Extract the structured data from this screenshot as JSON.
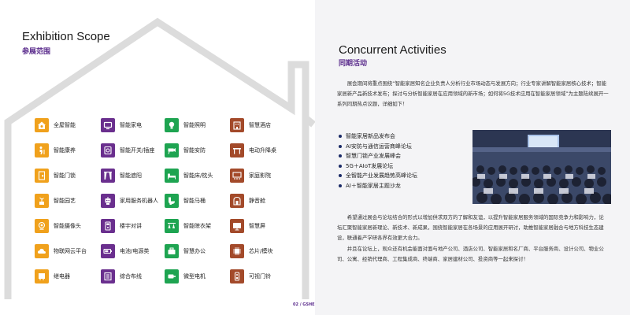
{
  "left": {
    "title_en": "Exhibition Scope",
    "title_cn": "参展范围",
    "items": [
      {
        "label": "全屋智能",
        "icon": "home-gear-icon",
        "color": "#f0a11c"
      },
      {
        "label": "智能家电",
        "icon": "tv-icon",
        "color": "#6a2f8e"
      },
      {
        "label": "智能照明",
        "icon": "bulb-icon",
        "color": "#1ea451"
      },
      {
        "label": "智慧酒店",
        "icon": "hotel-icon",
        "color": "#a34a2a"
      },
      {
        "label": "智能康养",
        "icon": "elderly-care-icon",
        "color": "#f0a11c"
      },
      {
        "label": "智能开关/插座",
        "icon": "power-switch-icon",
        "color": "#6a2f8e"
      },
      {
        "label": "智能安防",
        "icon": "camera-icon",
        "color": "#1ea451"
      },
      {
        "label": "电动升降桌",
        "icon": "desk-icon",
        "color": "#a34a2a"
      },
      {
        "label": "智能门锁",
        "icon": "door-lock-icon",
        "color": "#f0a11c"
      },
      {
        "label": "智能遮阳",
        "icon": "curtain-icon",
        "color": "#6a2f8e"
      },
      {
        "label": "智能床/枕头",
        "icon": "bed-icon",
        "color": "#1ea451"
      },
      {
        "label": "家庭影院",
        "icon": "theater-icon",
        "color": "#a34a2a"
      },
      {
        "label": "智能园艺",
        "icon": "garden-icon",
        "color": "#f0a11c"
      },
      {
        "label": "家用服务机器人",
        "icon": "robot-icon",
        "color": "#6a2f8e"
      },
      {
        "label": "智能马桶",
        "icon": "toilet-icon",
        "color": "#1ea451"
      },
      {
        "label": "静音舱",
        "icon": "pod-icon",
        "color": "#a34a2a"
      },
      {
        "label": "智能摄像头",
        "icon": "webcam-icon",
        "color": "#f0a11c"
      },
      {
        "label": "楼宇对讲",
        "icon": "intercom-icon",
        "color": "#6a2f8e"
      },
      {
        "label": "智能晾衣架",
        "icon": "clothes-rack-icon",
        "color": "#1ea451"
      },
      {
        "label": "智慧屏",
        "icon": "screen-icon",
        "color": "#a34a2a"
      },
      {
        "label": "物联网云平台",
        "icon": "cloud-icon",
        "color": "#f0a11c"
      },
      {
        "label": "电池/电源类",
        "icon": "battery-icon",
        "color": "#6a2f8e"
      },
      {
        "label": "智慧办公",
        "icon": "office-icon",
        "color": "#1ea451"
      },
      {
        "label": "芯片/模块",
        "icon": "chip-icon",
        "color": "#a34a2a"
      },
      {
        "label": "继电器",
        "icon": "relay-icon",
        "color": "#f0a11c"
      },
      {
        "label": "综合布线",
        "icon": "wiring-icon",
        "color": "#6a2f8e"
      },
      {
        "label": "微型电机",
        "icon": "motor-icon",
        "color": "#1ea451"
      },
      {
        "label": "可视门铃",
        "icon": "doorbell-icon",
        "color": "#a34a2a"
      }
    ]
  },
  "right": {
    "title_en": "Concurrent Activities",
    "title_cn": "同期活动",
    "intro": "展会期间将重点围绕“智能家居知名企业负责人分析行业市场动态与发展方向；行业专家讲解智能家居核心技术；智能家居新产品新技术发布；探讨与分析智能家居在应用领域的新市场；如何将5G技术应用在智能家居领域”为主题陆续展开一系列同期热点议题，详细如下！",
    "bullets": [
      "智能家居新品发布会",
      "AI安防与通信运营商峰论坛",
      "智慧门锁产业发展峰会",
      "5G＋AIoT发展论坛",
      "全智能产业发展趋势高峰论坛",
      "AI＋智能家居主题沙龙"
    ],
    "para2": "希望通过展会与论坛结合的形式以增加供求双方的了解和友谊，以提升智能家居服务领域的国际竞争力和影响力，论坛汇聚智能家居新理论、新技术、新成果，围绕智能家居在各场景的应用展开研讨，助推智能家居融合与地方科技生态建设，联通着产学研各界有效更大合力。",
    "para3": "并且在论坛上，观众还有机会能面对面与地产公司、酒店公司、智能家居和名厂商、平台服务商、设计公司、物业公司、公寓、经销代理商、工程集成商、终端商、家居建材公司、投资商等一起来探讨！"
  },
  "footer": {
    "page": "02 / GSHE"
  },
  "colors": {
    "accent": "#5a2b8c",
    "orange": "#f0a11c",
    "purple": "#6a2f8e",
    "green": "#1ea451",
    "brown": "#a34a2a"
  }
}
